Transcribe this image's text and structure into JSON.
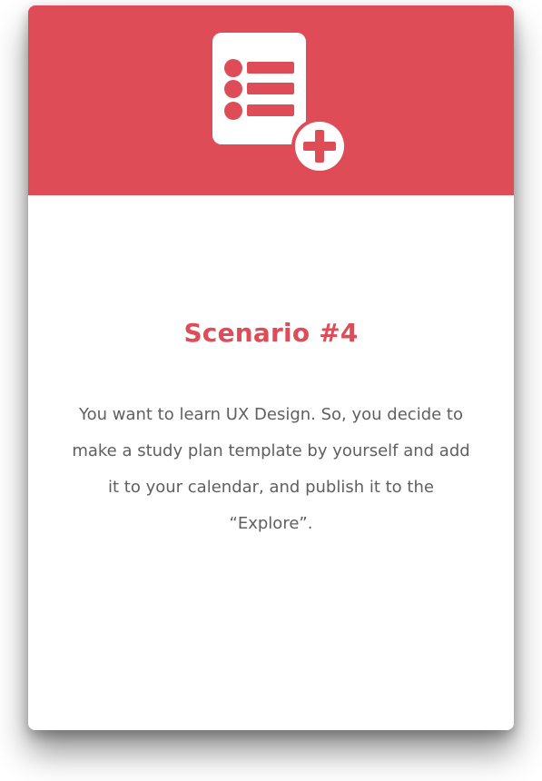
{
  "card": {
    "icon": "study-plan-add-icon",
    "title": "Scenario #4",
    "description": "You want to learn UX Design. So, you decide to make a study plan template by yourself and add it to your calendar, and publish it to the “Explore”."
  },
  "colors": {
    "accent": "#DE4C57",
    "text_body": "#5F5F5F",
    "background": "#FFFFFF"
  }
}
